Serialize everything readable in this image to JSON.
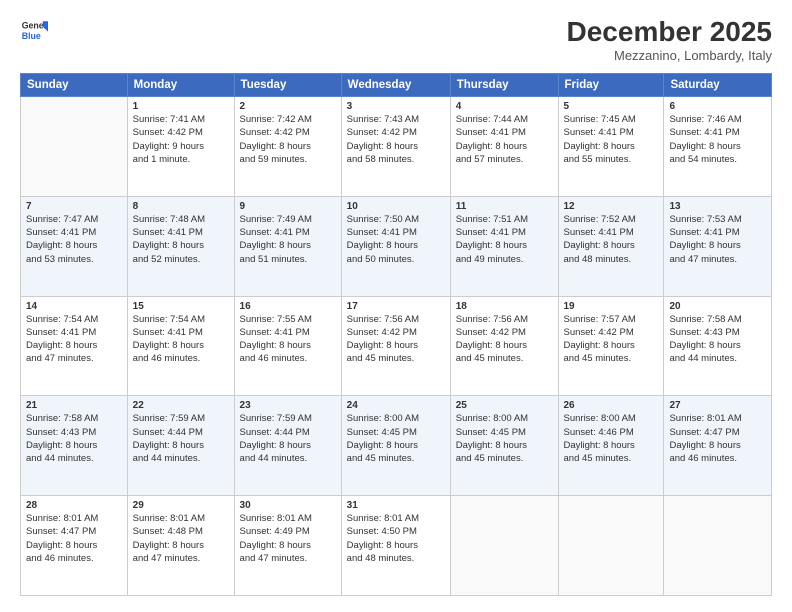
{
  "header": {
    "logo_line1": "General",
    "logo_line2": "Blue",
    "month": "December 2025",
    "location": "Mezzanino, Lombardy, Italy"
  },
  "days_of_week": [
    "Sunday",
    "Monday",
    "Tuesday",
    "Wednesday",
    "Thursday",
    "Friday",
    "Saturday"
  ],
  "weeks": [
    [
      {
        "day": "",
        "lines": []
      },
      {
        "day": "1",
        "lines": [
          "Sunrise: 7:41 AM",
          "Sunset: 4:42 PM",
          "Daylight: 9 hours",
          "and 1 minute."
        ]
      },
      {
        "day": "2",
        "lines": [
          "Sunrise: 7:42 AM",
          "Sunset: 4:42 PM",
          "Daylight: 8 hours",
          "and 59 minutes."
        ]
      },
      {
        "day": "3",
        "lines": [
          "Sunrise: 7:43 AM",
          "Sunset: 4:42 PM",
          "Daylight: 8 hours",
          "and 58 minutes."
        ]
      },
      {
        "day": "4",
        "lines": [
          "Sunrise: 7:44 AM",
          "Sunset: 4:41 PM",
          "Daylight: 8 hours",
          "and 57 minutes."
        ]
      },
      {
        "day": "5",
        "lines": [
          "Sunrise: 7:45 AM",
          "Sunset: 4:41 PM",
          "Daylight: 8 hours",
          "and 55 minutes."
        ]
      },
      {
        "day": "6",
        "lines": [
          "Sunrise: 7:46 AM",
          "Sunset: 4:41 PM",
          "Daylight: 8 hours",
          "and 54 minutes."
        ]
      }
    ],
    [
      {
        "day": "7",
        "lines": [
          "Sunrise: 7:47 AM",
          "Sunset: 4:41 PM",
          "Daylight: 8 hours",
          "and 53 minutes."
        ]
      },
      {
        "day": "8",
        "lines": [
          "Sunrise: 7:48 AM",
          "Sunset: 4:41 PM",
          "Daylight: 8 hours",
          "and 52 minutes."
        ]
      },
      {
        "day": "9",
        "lines": [
          "Sunrise: 7:49 AM",
          "Sunset: 4:41 PM",
          "Daylight: 8 hours",
          "and 51 minutes."
        ]
      },
      {
        "day": "10",
        "lines": [
          "Sunrise: 7:50 AM",
          "Sunset: 4:41 PM",
          "Daylight: 8 hours",
          "and 50 minutes."
        ]
      },
      {
        "day": "11",
        "lines": [
          "Sunrise: 7:51 AM",
          "Sunset: 4:41 PM",
          "Daylight: 8 hours",
          "and 49 minutes."
        ]
      },
      {
        "day": "12",
        "lines": [
          "Sunrise: 7:52 AM",
          "Sunset: 4:41 PM",
          "Daylight: 8 hours",
          "and 48 minutes."
        ]
      },
      {
        "day": "13",
        "lines": [
          "Sunrise: 7:53 AM",
          "Sunset: 4:41 PM",
          "Daylight: 8 hours",
          "and 47 minutes."
        ]
      }
    ],
    [
      {
        "day": "14",
        "lines": [
          "Sunrise: 7:54 AM",
          "Sunset: 4:41 PM",
          "Daylight: 8 hours",
          "and 47 minutes."
        ]
      },
      {
        "day": "15",
        "lines": [
          "Sunrise: 7:54 AM",
          "Sunset: 4:41 PM",
          "Daylight: 8 hours",
          "and 46 minutes."
        ]
      },
      {
        "day": "16",
        "lines": [
          "Sunrise: 7:55 AM",
          "Sunset: 4:41 PM",
          "Daylight: 8 hours",
          "and 46 minutes."
        ]
      },
      {
        "day": "17",
        "lines": [
          "Sunrise: 7:56 AM",
          "Sunset: 4:42 PM",
          "Daylight: 8 hours",
          "and 45 minutes."
        ]
      },
      {
        "day": "18",
        "lines": [
          "Sunrise: 7:56 AM",
          "Sunset: 4:42 PM",
          "Daylight: 8 hours",
          "and 45 minutes."
        ]
      },
      {
        "day": "19",
        "lines": [
          "Sunrise: 7:57 AM",
          "Sunset: 4:42 PM",
          "Daylight: 8 hours",
          "and 45 minutes."
        ]
      },
      {
        "day": "20",
        "lines": [
          "Sunrise: 7:58 AM",
          "Sunset: 4:43 PM",
          "Daylight: 8 hours",
          "and 44 minutes."
        ]
      }
    ],
    [
      {
        "day": "21",
        "lines": [
          "Sunrise: 7:58 AM",
          "Sunset: 4:43 PM",
          "Daylight: 8 hours",
          "and 44 minutes."
        ]
      },
      {
        "day": "22",
        "lines": [
          "Sunrise: 7:59 AM",
          "Sunset: 4:44 PM",
          "Daylight: 8 hours",
          "and 44 minutes."
        ]
      },
      {
        "day": "23",
        "lines": [
          "Sunrise: 7:59 AM",
          "Sunset: 4:44 PM",
          "Daylight: 8 hours",
          "and 44 minutes."
        ]
      },
      {
        "day": "24",
        "lines": [
          "Sunrise: 8:00 AM",
          "Sunset: 4:45 PM",
          "Daylight: 8 hours",
          "and 45 minutes."
        ]
      },
      {
        "day": "25",
        "lines": [
          "Sunrise: 8:00 AM",
          "Sunset: 4:45 PM",
          "Daylight: 8 hours",
          "and 45 minutes."
        ]
      },
      {
        "day": "26",
        "lines": [
          "Sunrise: 8:00 AM",
          "Sunset: 4:46 PM",
          "Daylight: 8 hours",
          "and 45 minutes."
        ]
      },
      {
        "day": "27",
        "lines": [
          "Sunrise: 8:01 AM",
          "Sunset: 4:47 PM",
          "Daylight: 8 hours",
          "and 46 minutes."
        ]
      }
    ],
    [
      {
        "day": "28",
        "lines": [
          "Sunrise: 8:01 AM",
          "Sunset: 4:47 PM",
          "Daylight: 8 hours",
          "and 46 minutes."
        ]
      },
      {
        "day": "29",
        "lines": [
          "Sunrise: 8:01 AM",
          "Sunset: 4:48 PM",
          "Daylight: 8 hours",
          "and 47 minutes."
        ]
      },
      {
        "day": "30",
        "lines": [
          "Sunrise: 8:01 AM",
          "Sunset: 4:49 PM",
          "Daylight: 8 hours",
          "and 47 minutes."
        ]
      },
      {
        "day": "31",
        "lines": [
          "Sunrise: 8:01 AM",
          "Sunset: 4:50 PM",
          "Daylight: 8 hours",
          "and 48 minutes."
        ]
      },
      {
        "day": "",
        "lines": []
      },
      {
        "day": "",
        "lines": []
      },
      {
        "day": "",
        "lines": []
      }
    ]
  ]
}
